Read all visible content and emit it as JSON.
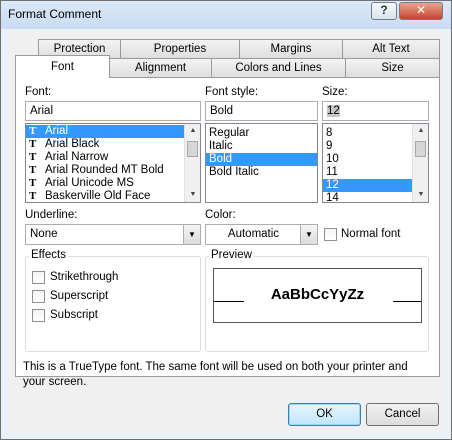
{
  "window": {
    "title": "Format Comment",
    "help_glyph": "?",
    "close_glyph": "✕"
  },
  "tabs_back": [
    {
      "label": "Protection"
    },
    {
      "label": "Properties"
    },
    {
      "label": "Margins"
    },
    {
      "label": "Alt Text"
    }
  ],
  "tabs_front": [
    {
      "label": "Font"
    },
    {
      "label": "Alignment"
    },
    {
      "label": "Colors and Lines"
    },
    {
      "label": "Size"
    }
  ],
  "font": {
    "label": "Font:",
    "value": "Arial",
    "icon_glyph": "T",
    "items": [
      "Arial",
      "Arial Black",
      "Arial Narrow",
      "Arial Rounded MT Bold",
      "Arial Unicode MS",
      "Baskerville Old Face"
    ],
    "selected": "Arial"
  },
  "font_style": {
    "label": "Font style:",
    "value": "Bold",
    "items": [
      "Regular",
      "Italic",
      "Bold",
      "Bold Italic"
    ],
    "selected": "Bold"
  },
  "size": {
    "label": "Size:",
    "value": "12",
    "items": [
      "8",
      "9",
      "10",
      "11",
      "12",
      "14"
    ],
    "selected": "12"
  },
  "underline": {
    "label": "Underline:",
    "value": "None"
  },
  "color": {
    "label": "Color:",
    "value": "Automatic"
  },
  "normal_font": {
    "label": "Normal font",
    "checked": false
  },
  "effects": {
    "title": "Effects",
    "strikethrough": {
      "label": "Strikethrough",
      "checked": false
    },
    "superscript": {
      "label": "Superscript",
      "checked": false
    },
    "subscript": {
      "label": "Subscript",
      "checked": false
    }
  },
  "preview": {
    "title": "Preview",
    "sample": "AaBbCcYyZz"
  },
  "info_text": "This is a TrueType font.  The same font will be used on both your printer and your screen.",
  "buttons": {
    "ok": "OK",
    "cancel": "Cancel"
  },
  "colors": {
    "selection": "#3399ff",
    "dialog_bg": "#f0f0f0",
    "panel_bg": "#ffffff"
  }
}
